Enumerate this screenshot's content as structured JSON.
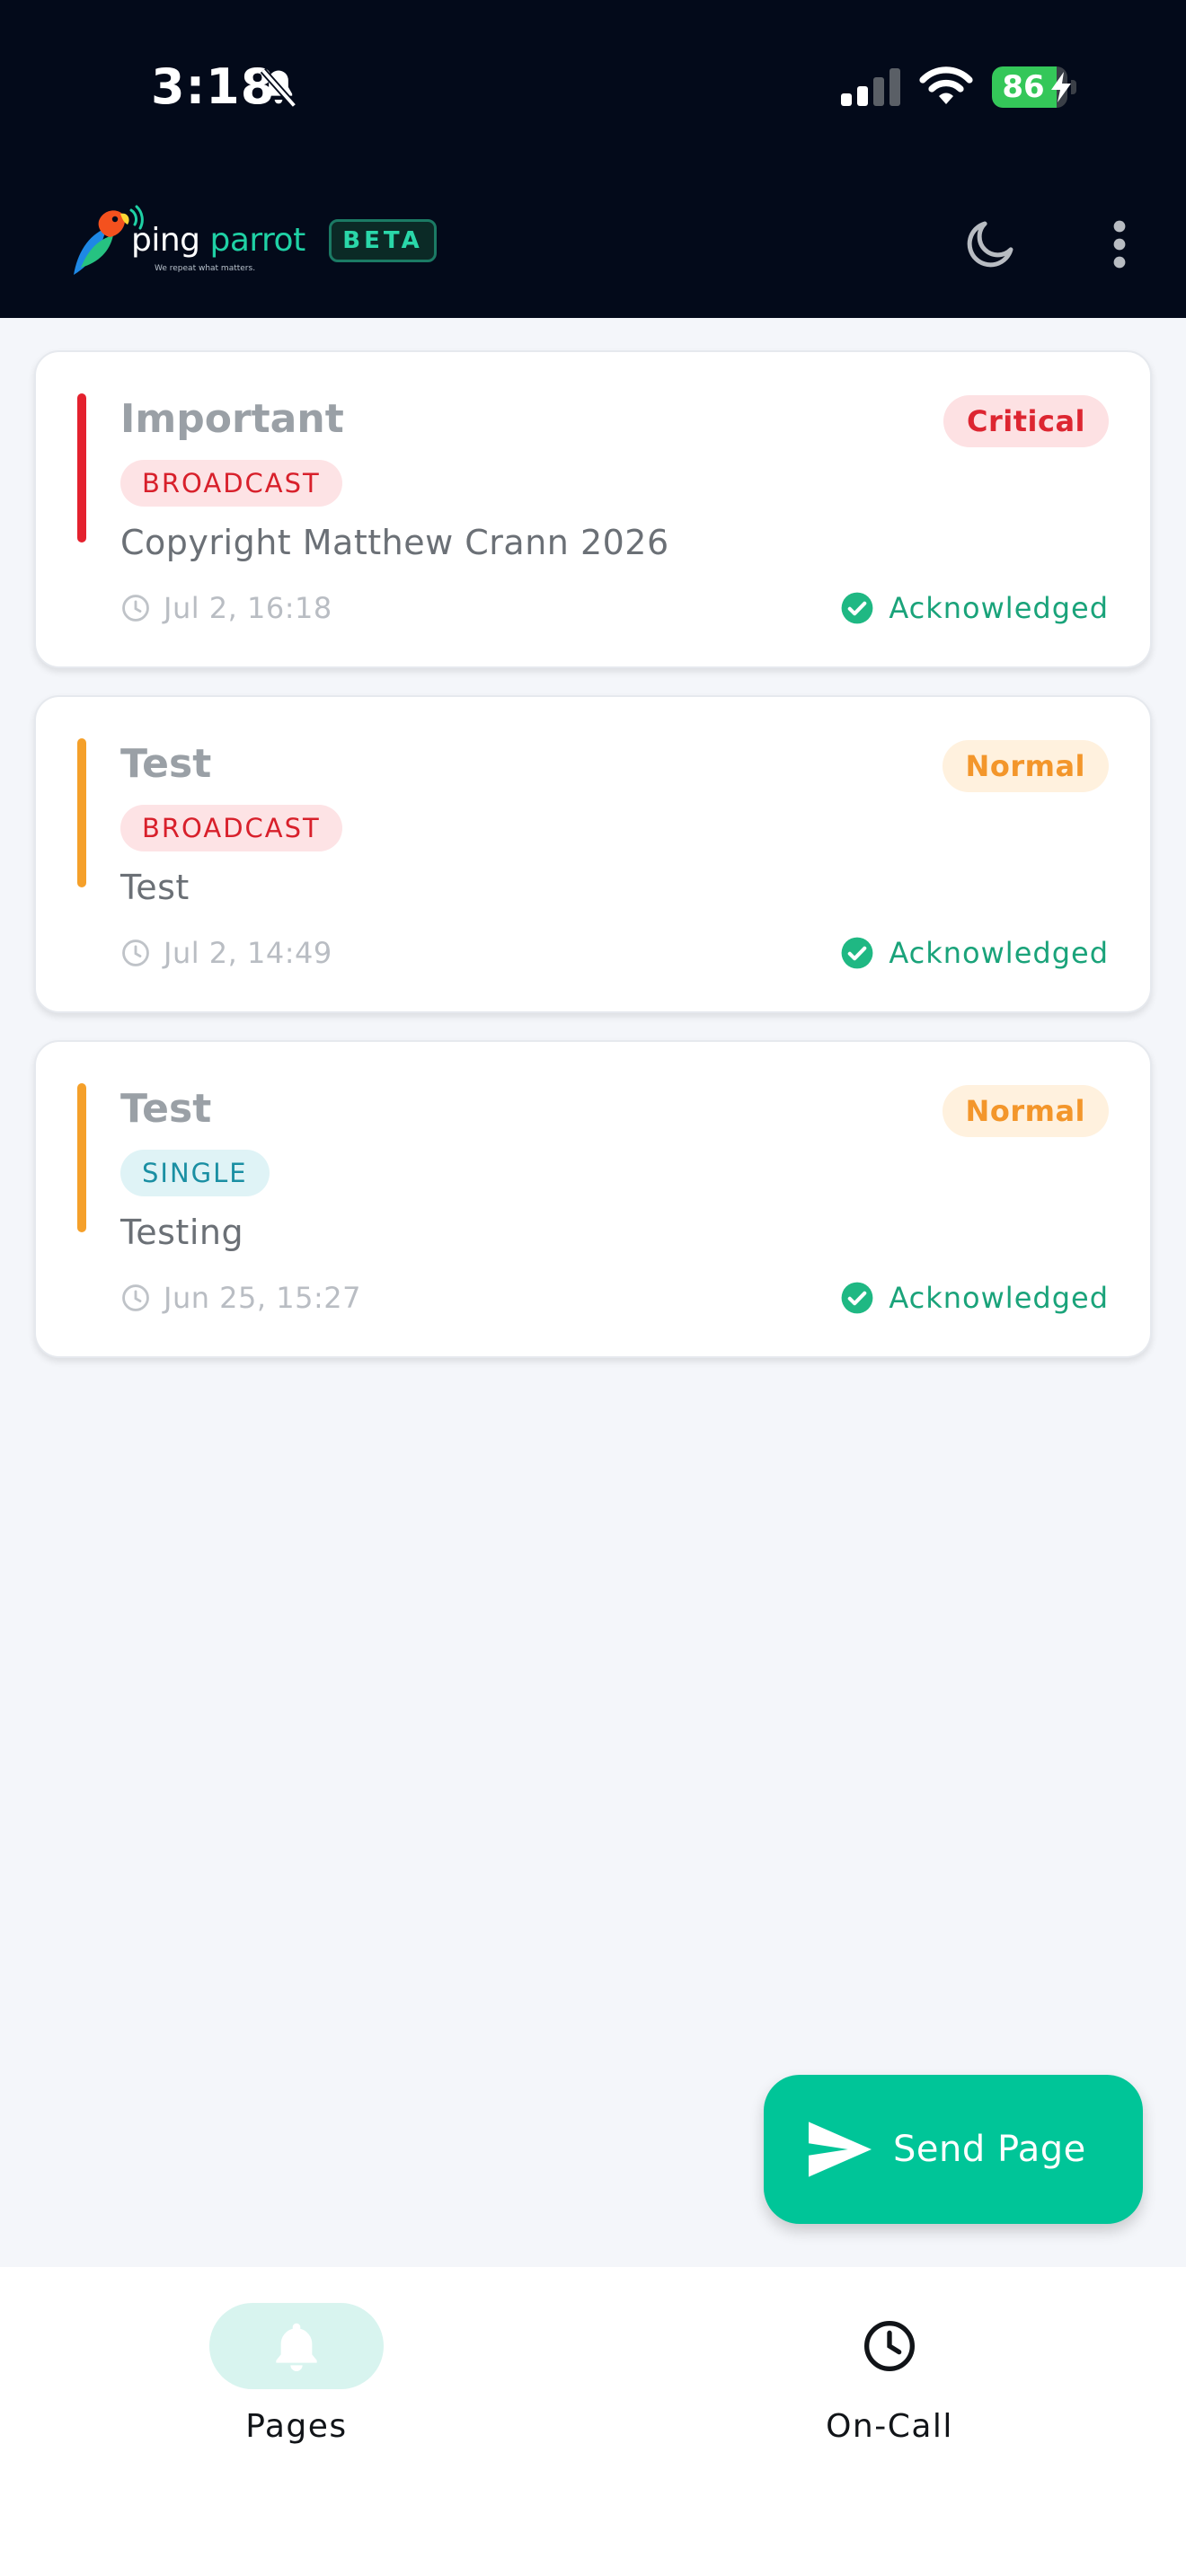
{
  "status_bar": {
    "time": "3:18",
    "battery": "86"
  },
  "header": {
    "logo_text_main": "ping ",
    "logo_text_accent": "parrot",
    "logo_tagline": "We repeat what matters.",
    "beta_label": "BETA"
  },
  "pages": [
    {
      "title": "Important",
      "priority": "Critical",
      "type": "BROADCAST",
      "message": "Copyright Matthew Crann 2026",
      "time": "Jul 2, 16:18",
      "status": "Acknowledged"
    },
    {
      "title": "Test",
      "priority": "Normal",
      "type": "BROADCAST",
      "message": "Test",
      "time": "Jul 2, 14:49",
      "status": "Acknowledged"
    },
    {
      "title": "Test",
      "priority": "Normal",
      "type": "SINGLE",
      "message": "Testing",
      "time": "Jun 25, 15:27",
      "status": "Acknowledged"
    }
  ],
  "fab": {
    "label": "Send Page"
  },
  "bottom_nav": {
    "items": [
      {
        "label": "Pages",
        "icon": "bell-icon",
        "active": true
      },
      {
        "label": "On-Call",
        "icon": "clock-icon",
        "active": false
      }
    ]
  },
  "colors": {
    "header_bg": "#030a1a",
    "accent": "#00c598",
    "critical": "#dd2631",
    "normal": "#f3962b",
    "acknowledged": "#1aa37a"
  },
  "icons": [
    "bell-off-icon",
    "signal-icon",
    "wifi-icon",
    "battery-icon",
    "moon-icon",
    "more-vert-icon",
    "clock-icon",
    "check-circle-icon",
    "send-icon",
    "bell-icon"
  ]
}
